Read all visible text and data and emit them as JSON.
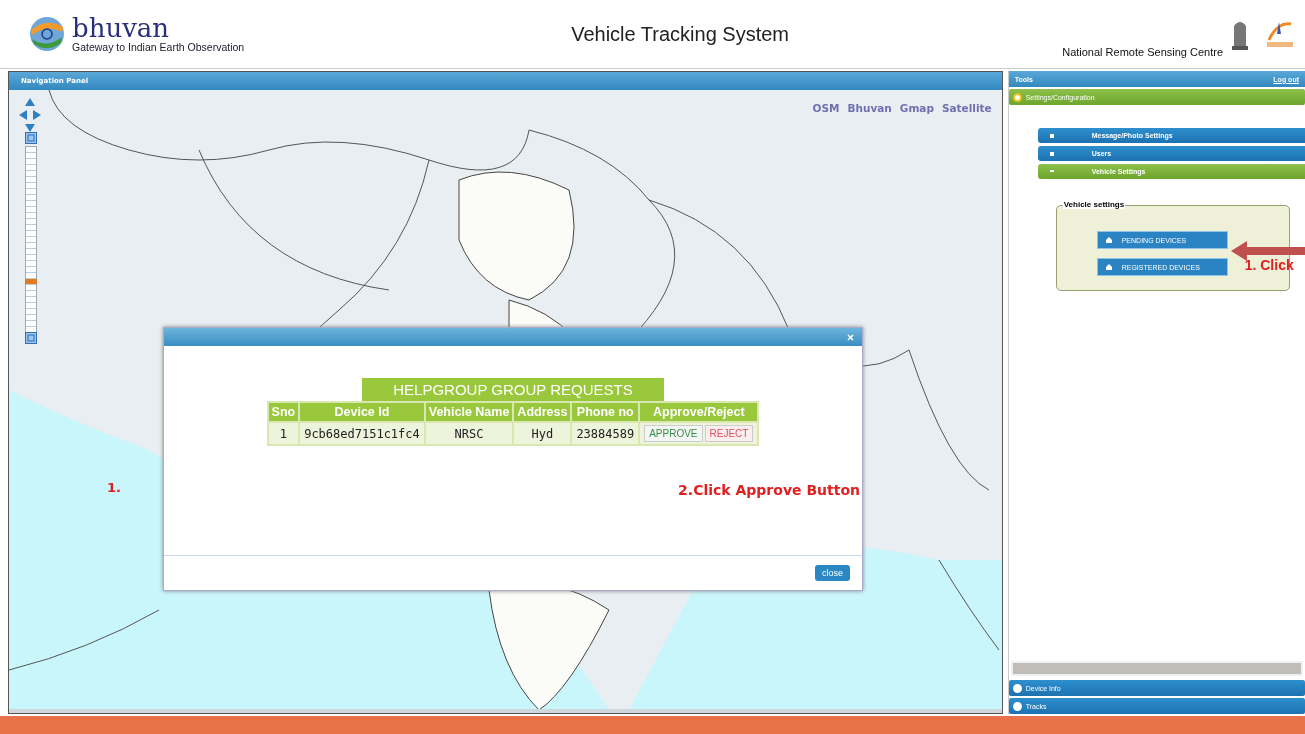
{
  "header": {
    "logo_title": "bhuvan",
    "logo_subtitle": "Gateway to Indian Earth Observation",
    "title": "Vehicle Tracking System",
    "organization": "National Remote Sensing Centre"
  },
  "navigation_panel": {
    "title": "Navigation Panel",
    "layers": [
      {
        "label": "OSM"
      },
      {
        "label": "Bhuvan"
      },
      {
        "label": "Gmap"
      },
      {
        "label": "Satellite"
      }
    ],
    "zoom_slider": {
      "level": 0.27
    }
  },
  "dialog": {
    "table_title": "HELPGROUP GROUP REQUESTS",
    "columns": [
      "Sno",
      "Device Id",
      "Vehicle Name",
      "Address",
      "Phone no",
      "Approve/Reject"
    ],
    "rows": [
      {
        "sno": "1",
        "device_id": "9cb68ed7151c1fc4",
        "vehicle_name": "NRSC",
        "address": "Hyd",
        "phone_no": "23884589",
        "actions": [
          {
            "label": "APPROVE",
            "kind": "approve"
          },
          {
            "label": "REJECT",
            "kind": "reject"
          }
        ]
      }
    ],
    "close_button": "close"
  },
  "tools_panel": {
    "title": "Tools",
    "logout": "Log out",
    "sections": [
      {
        "label": "Settings/Configuration",
        "expanded": true
      },
      {
        "label": "Device Info",
        "expanded": false
      },
      {
        "label": "Tracks",
        "expanded": false
      }
    ],
    "settings_items": [
      {
        "label": "Message/Photo Settings",
        "expanded": false
      },
      {
        "label": "Users",
        "expanded": false
      },
      {
        "label": "Vehicle Settings",
        "expanded": true
      }
    ],
    "vehicle_settings": {
      "legend": "Vehicle settings",
      "buttons": [
        "PENDING DEVICES",
        "REGISTERED DEVICES"
      ]
    }
  },
  "annotations": [
    {
      "text": "1."
    },
    {
      "text": "2.Click Approve Button"
    },
    {
      "text": "1. Click"
    }
  ]
}
